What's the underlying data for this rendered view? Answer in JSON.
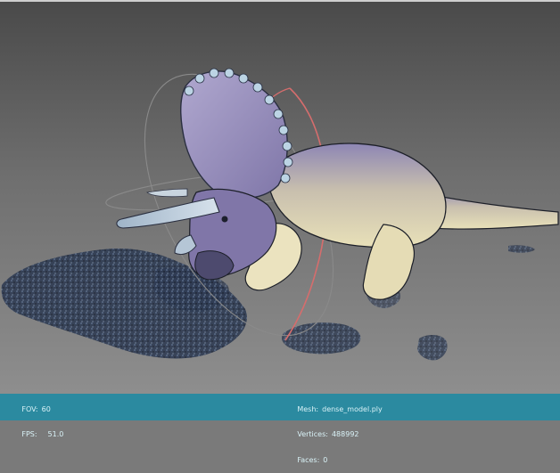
{
  "viewer": {
    "fov_label": "FOV:",
    "fov_value": "60",
    "fps_label": "FPS:",
    "fps_value": "51.0"
  },
  "model": {
    "mesh_label": "Mesh:",
    "mesh_value": "dense_model.ply",
    "vertices_label": "Vertices:",
    "vertices_value": "488992",
    "faces_label": "Faces:",
    "faces_value": "0"
  },
  "colors": {
    "statusbar": "#2b8aa0",
    "status_text": "#d9f2f7",
    "arcball_ring_red": "#d56d6d",
    "arcball_ring_gray": "#8a8a8a",
    "model_body": "#d9cfa0",
    "model_frill": "#8f86b8"
  },
  "icons": {
    "model": "triceratops-point-cloud",
    "gizmo": "arcball-rotation-rings"
  }
}
